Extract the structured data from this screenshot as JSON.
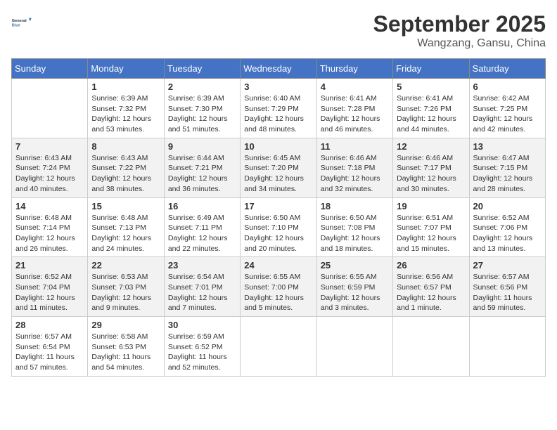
{
  "header": {
    "logo_line1": "General",
    "logo_line2": "Blue",
    "month": "September 2025",
    "location": "Wangzang, Gansu, China"
  },
  "days_of_week": [
    "Sunday",
    "Monday",
    "Tuesday",
    "Wednesday",
    "Thursday",
    "Friday",
    "Saturday"
  ],
  "weeks": [
    [
      {
        "day": "",
        "info": ""
      },
      {
        "day": "1",
        "info": "Sunrise: 6:39 AM\nSunset: 7:32 PM\nDaylight: 12 hours\nand 53 minutes."
      },
      {
        "day": "2",
        "info": "Sunrise: 6:39 AM\nSunset: 7:30 PM\nDaylight: 12 hours\nand 51 minutes."
      },
      {
        "day": "3",
        "info": "Sunrise: 6:40 AM\nSunset: 7:29 PM\nDaylight: 12 hours\nand 48 minutes."
      },
      {
        "day": "4",
        "info": "Sunrise: 6:41 AM\nSunset: 7:28 PM\nDaylight: 12 hours\nand 46 minutes."
      },
      {
        "day": "5",
        "info": "Sunrise: 6:41 AM\nSunset: 7:26 PM\nDaylight: 12 hours\nand 44 minutes."
      },
      {
        "day": "6",
        "info": "Sunrise: 6:42 AM\nSunset: 7:25 PM\nDaylight: 12 hours\nand 42 minutes."
      }
    ],
    [
      {
        "day": "7",
        "info": "Sunrise: 6:43 AM\nSunset: 7:24 PM\nDaylight: 12 hours\nand 40 minutes."
      },
      {
        "day": "8",
        "info": "Sunrise: 6:43 AM\nSunset: 7:22 PM\nDaylight: 12 hours\nand 38 minutes."
      },
      {
        "day": "9",
        "info": "Sunrise: 6:44 AM\nSunset: 7:21 PM\nDaylight: 12 hours\nand 36 minutes."
      },
      {
        "day": "10",
        "info": "Sunrise: 6:45 AM\nSunset: 7:20 PM\nDaylight: 12 hours\nand 34 minutes."
      },
      {
        "day": "11",
        "info": "Sunrise: 6:46 AM\nSunset: 7:18 PM\nDaylight: 12 hours\nand 32 minutes."
      },
      {
        "day": "12",
        "info": "Sunrise: 6:46 AM\nSunset: 7:17 PM\nDaylight: 12 hours\nand 30 minutes."
      },
      {
        "day": "13",
        "info": "Sunrise: 6:47 AM\nSunset: 7:15 PM\nDaylight: 12 hours\nand 28 minutes."
      }
    ],
    [
      {
        "day": "14",
        "info": "Sunrise: 6:48 AM\nSunset: 7:14 PM\nDaylight: 12 hours\nand 26 minutes."
      },
      {
        "day": "15",
        "info": "Sunrise: 6:48 AM\nSunset: 7:13 PM\nDaylight: 12 hours\nand 24 minutes."
      },
      {
        "day": "16",
        "info": "Sunrise: 6:49 AM\nSunset: 7:11 PM\nDaylight: 12 hours\nand 22 minutes."
      },
      {
        "day": "17",
        "info": "Sunrise: 6:50 AM\nSunset: 7:10 PM\nDaylight: 12 hours\nand 20 minutes."
      },
      {
        "day": "18",
        "info": "Sunrise: 6:50 AM\nSunset: 7:08 PM\nDaylight: 12 hours\nand 18 minutes."
      },
      {
        "day": "19",
        "info": "Sunrise: 6:51 AM\nSunset: 7:07 PM\nDaylight: 12 hours\nand 15 minutes."
      },
      {
        "day": "20",
        "info": "Sunrise: 6:52 AM\nSunset: 7:06 PM\nDaylight: 12 hours\nand 13 minutes."
      }
    ],
    [
      {
        "day": "21",
        "info": "Sunrise: 6:52 AM\nSunset: 7:04 PM\nDaylight: 12 hours\nand 11 minutes."
      },
      {
        "day": "22",
        "info": "Sunrise: 6:53 AM\nSunset: 7:03 PM\nDaylight: 12 hours\nand 9 minutes."
      },
      {
        "day": "23",
        "info": "Sunrise: 6:54 AM\nSunset: 7:01 PM\nDaylight: 12 hours\nand 7 minutes."
      },
      {
        "day": "24",
        "info": "Sunrise: 6:55 AM\nSunset: 7:00 PM\nDaylight: 12 hours\nand 5 minutes."
      },
      {
        "day": "25",
        "info": "Sunrise: 6:55 AM\nSunset: 6:59 PM\nDaylight: 12 hours\nand 3 minutes."
      },
      {
        "day": "26",
        "info": "Sunrise: 6:56 AM\nSunset: 6:57 PM\nDaylight: 12 hours\nand 1 minute."
      },
      {
        "day": "27",
        "info": "Sunrise: 6:57 AM\nSunset: 6:56 PM\nDaylight: 11 hours\nand 59 minutes."
      }
    ],
    [
      {
        "day": "28",
        "info": "Sunrise: 6:57 AM\nSunset: 6:54 PM\nDaylight: 11 hours\nand 57 minutes."
      },
      {
        "day": "29",
        "info": "Sunrise: 6:58 AM\nSunset: 6:53 PM\nDaylight: 11 hours\nand 54 minutes."
      },
      {
        "day": "30",
        "info": "Sunrise: 6:59 AM\nSunset: 6:52 PM\nDaylight: 11 hours\nand 52 minutes."
      },
      {
        "day": "",
        "info": ""
      },
      {
        "day": "",
        "info": ""
      },
      {
        "day": "",
        "info": ""
      },
      {
        "day": "",
        "info": ""
      }
    ]
  ]
}
